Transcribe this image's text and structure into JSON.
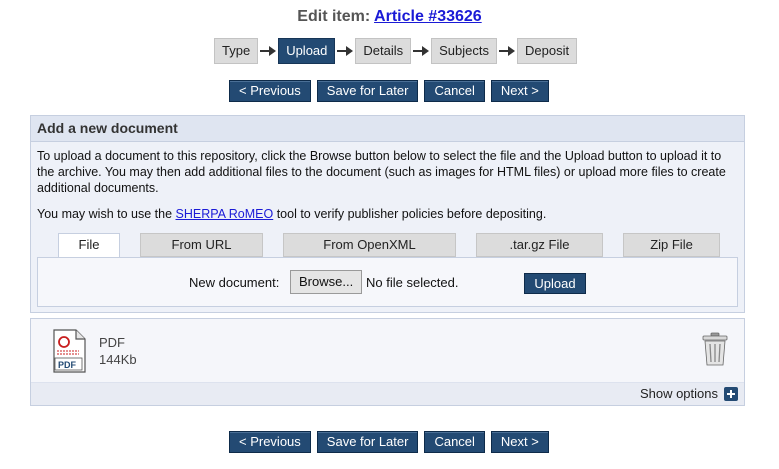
{
  "header": {
    "prefix": "Edit item:",
    "item_link": "Article #33626"
  },
  "workflow": {
    "stages": [
      "Type",
      "Upload",
      "Details",
      "Subjects",
      "Deposit"
    ],
    "current": "Upload"
  },
  "nav_top": {
    "previous": "< Previous",
    "save_later": "Save for Later",
    "cancel": "Cancel",
    "next": "Next >"
  },
  "add_panel": {
    "title": "Add a new document",
    "intro": "To upload a document to this repository, click the Browse button below to select the file and the Upload button to upload it to the archive. You may then add additional files to the document (such as images for HTML files) or upload more files to create additional documents.",
    "sherpa_prefix": "You may wish to use the ",
    "sherpa_link": "SHERPA RoMEO",
    "sherpa_suffix": " tool to verify publisher policies before depositing.",
    "tabs": [
      "File",
      "From URL",
      "From OpenXML",
      ".tar.gz File",
      "Zip File"
    ],
    "active_tab": "File",
    "new_doc_label": "New document:",
    "browse_label": "Browse...",
    "no_file_text": "No file selected.",
    "upload_label": "Upload"
  },
  "document": {
    "icon": "pdf-file-icon",
    "type": "PDF",
    "size": "144Kb",
    "delete_icon": "trash-icon",
    "show_options": "Show options"
  },
  "nav_bottom": {
    "previous": "< Previous",
    "save_later": "Save for Later",
    "cancel": "Cancel",
    "next": "Next >"
  },
  "colors": {
    "accent": "#234a73",
    "link": "#1a1ad6",
    "panel_bg": "#eef1f8"
  }
}
